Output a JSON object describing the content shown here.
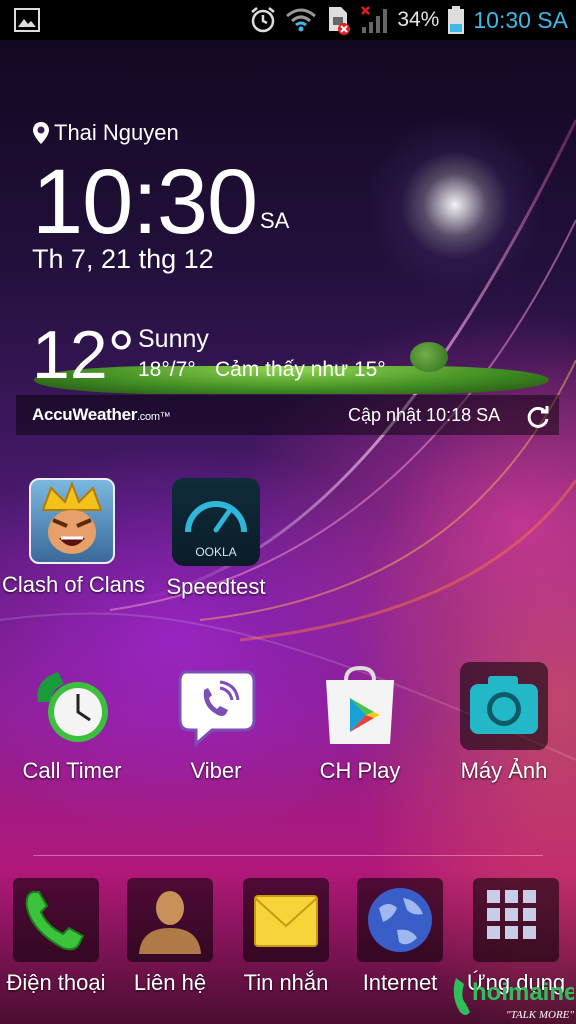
{
  "status_bar": {
    "battery_percent": "34%",
    "time": "10:30 SA",
    "icons": [
      "gallery-icon",
      "alarm-icon",
      "wifi-icon",
      "sim-error-icon",
      "signal-icon",
      "battery-icon"
    ]
  },
  "weather": {
    "location": "Thai Nguyen",
    "time": "10:30",
    "ampm": "SA",
    "date": "Th 7, 21 thg 12",
    "temperature": "12°",
    "condition": "Sunny",
    "hi_lo": "18°/7°",
    "feels_like": "Cảm thấy như 15°",
    "provider": "AccuWeather",
    "provider_suffix": ".com",
    "provider_tm": "™",
    "updated": "Cập nhật 10:18 SA"
  },
  "home_apps": [
    {
      "label": "Clash of Clans",
      "icon": "clash-of-clans-icon"
    },
    {
      "label": "Speedtest",
      "icon": "speedtest-icon",
      "sublabel": "OOKLA"
    },
    {
      "label": "Call Timer",
      "icon": "call-timer-icon"
    },
    {
      "label": "Viber",
      "icon": "viber-icon"
    },
    {
      "label": "CH Play",
      "icon": "ch-play-icon"
    },
    {
      "label": "Máy Ảnh",
      "icon": "camera-icon"
    }
  ],
  "dock": [
    {
      "label": "Điện thoại",
      "icon": "phone-icon"
    },
    {
      "label": "Liên hệ",
      "icon": "contacts-icon"
    },
    {
      "label": "Tin nhắn",
      "icon": "messages-icon"
    },
    {
      "label": "Internet",
      "icon": "internet-globe-icon"
    },
    {
      "label": "Ứng dụng",
      "icon": "app-drawer-icon"
    }
  ],
  "watermark": {
    "name": "hoimaine",
    "tagline": "\"TALK MORE\""
  },
  "colors": {
    "accent_blue": "#3fb8e8",
    "status_bg": "#000000"
  }
}
